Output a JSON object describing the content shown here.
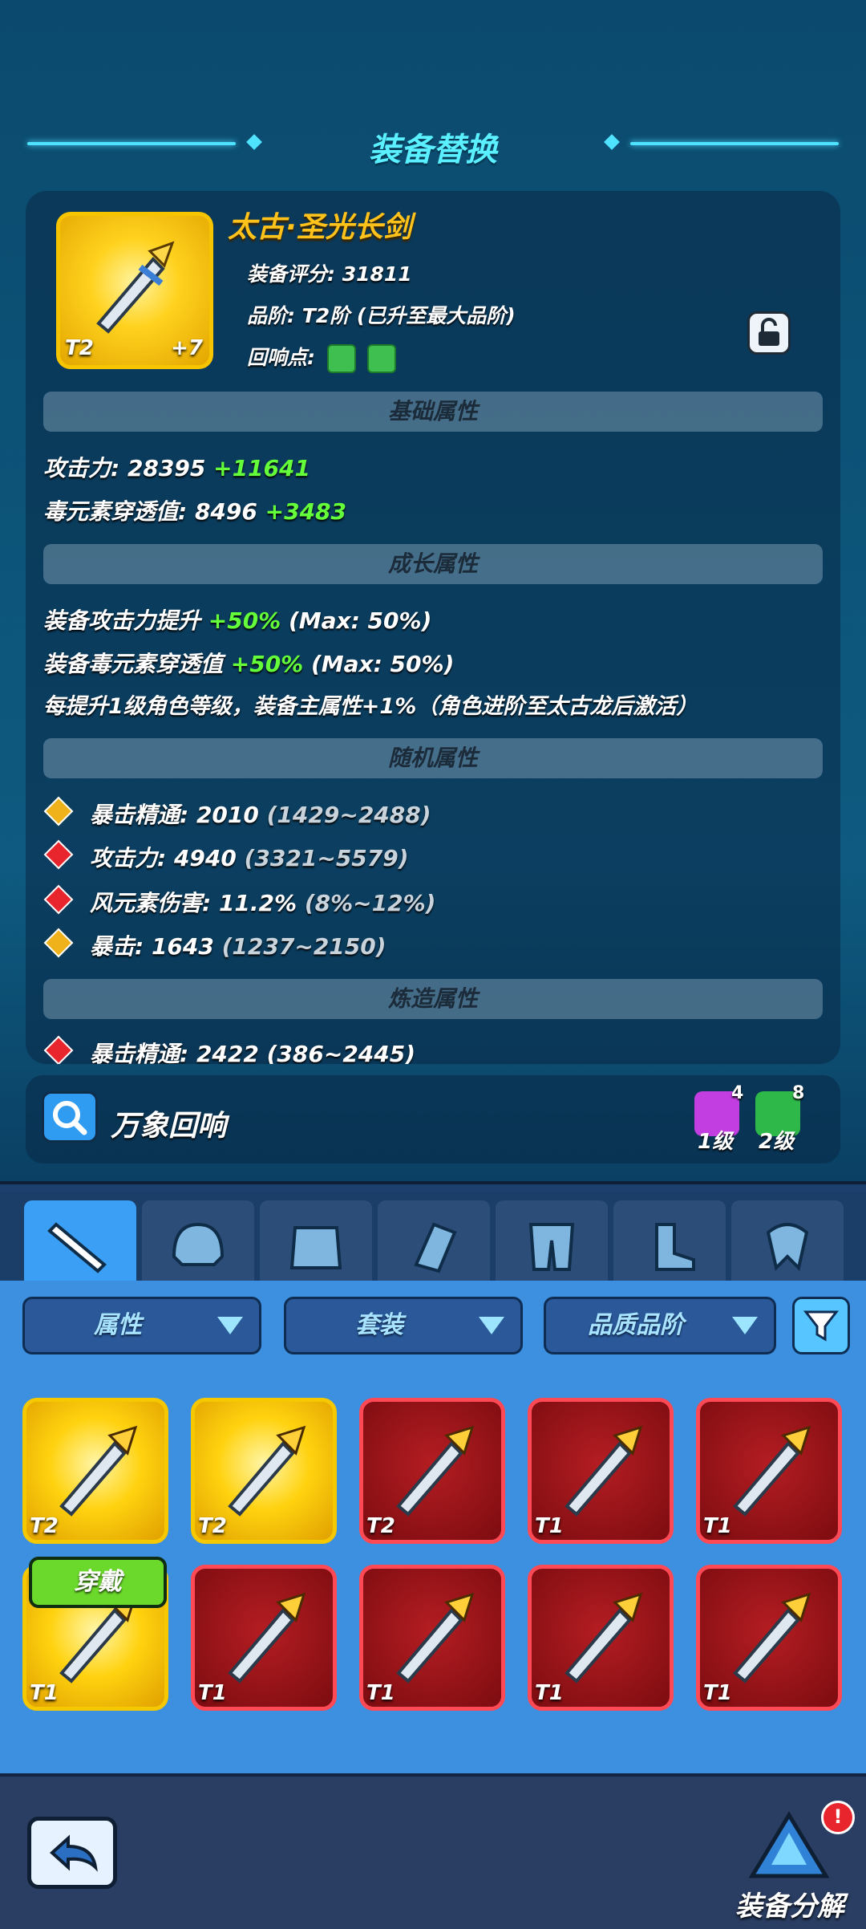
{
  "header": {
    "title": "装备替换"
  },
  "item": {
    "name": "太古·圣光长剑",
    "tier": "T2",
    "enhance": "+7",
    "score_label": "装备评分: 31811",
    "grade_label": "品阶: T2阶 (已升至最大品阶)",
    "echo_label": "回响点:"
  },
  "sections": {
    "basic": "基础属性",
    "growth": "成长属性",
    "random": "随机属性",
    "forge": "炼造属性"
  },
  "basic_stats": [
    {
      "label": "攻击力: 28395 ",
      "bonus": "+11641"
    },
    {
      "label": "毒元素穿透值: 8496 ",
      "bonus": "+3483"
    }
  ],
  "growth_stats": [
    {
      "label": "装备攻击力提升 ",
      "bonus": "+50%",
      "suffix": " (Max: 50%)"
    },
    {
      "label": "装备毒元素穿透值 ",
      "bonus": "+50%",
      "suffix": " (Max: 50%)"
    },
    {
      "label": "每提升1级角色等级，装备主属性+1%（角色进阶至太古龙后激活）",
      "bonus": "",
      "suffix": ""
    }
  ],
  "random_stats": [
    {
      "label": "暴击精通: 2010 ",
      "range": "(1429~2488)",
      "color": "#f0b21a"
    },
    {
      "label": "攻击力: 4940 ",
      "range": "(3321~5579)",
      "color": "#e8242c"
    },
    {
      "label": "风元素伤害: 11.2% ",
      "range": "(8%~12%)",
      "color": "#e8242c"
    },
    {
      "label": "暴击: 1643 ",
      "range": "(1237~2150)",
      "color": "#f0b21a"
    }
  ],
  "forge_partial": "暴击精通: 2422 (386~2445)",
  "echo": {
    "label": "万象回响",
    "badge1_count": "4",
    "badge1_level": "1级",
    "badge2_count": "8",
    "badge2_level": "2级"
  },
  "tabs": [
    {
      "name": "weapon"
    },
    {
      "name": "helmet"
    },
    {
      "name": "armor"
    },
    {
      "name": "bracer"
    },
    {
      "name": "pants"
    },
    {
      "name": "boots"
    },
    {
      "name": "accessory"
    }
  ],
  "filters": {
    "attr": "属性",
    "set": "套装",
    "quality": "品质品阶"
  },
  "grid": [
    {
      "tier": "T2",
      "rarity": "gold"
    },
    {
      "tier": "T2",
      "rarity": "gold"
    },
    {
      "tier": "T2",
      "rarity": "red"
    },
    {
      "tier": "T1",
      "rarity": "red"
    },
    {
      "tier": "T1",
      "rarity": "red"
    },
    {
      "tier": "T1",
      "rarity": "gold"
    },
    {
      "tier": "T1",
      "rarity": "red"
    },
    {
      "tier": "T1",
      "rarity": "red"
    },
    {
      "tier": "T1",
      "rarity": "red"
    },
    {
      "tier": "T1",
      "rarity": "red"
    }
  ],
  "equip_button": "穿戴",
  "footer": {
    "decompose": "装备分解",
    "alert": "!"
  },
  "colors": {
    "accent": "#4fe3ff",
    "gold": "#ffc21a",
    "green": "#64ff3a",
    "red_card": "#ff4a55"
  }
}
